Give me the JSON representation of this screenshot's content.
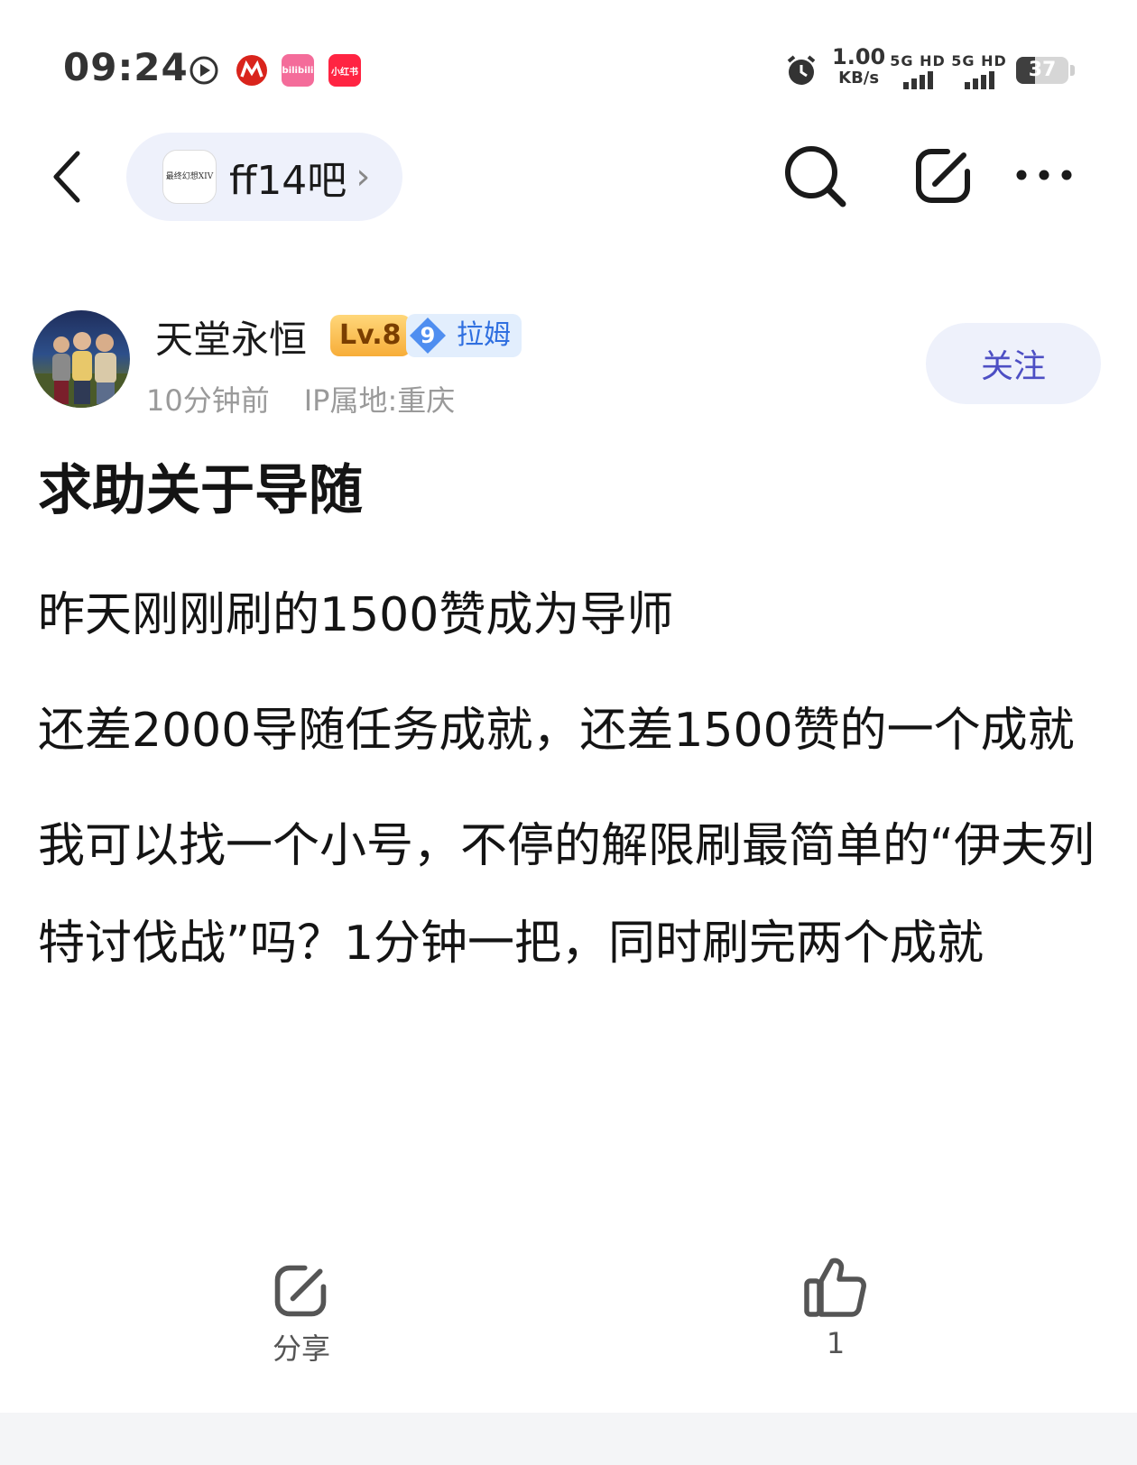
{
  "status_bar": {
    "time": "09:24",
    "app_icons": [
      {
        "name": "play-circle-icon"
      },
      {
        "name": "china-merchants-bank-icon",
        "color": "#d9241c"
      },
      {
        "name": "bilibili-icon",
        "label": "bilibili",
        "color": "#f46c9a"
      },
      {
        "name": "xiaohongshu-icon",
        "label": "小红书",
        "color": "#ff2442"
      }
    ],
    "alarm_icon": "alarm-clock-icon",
    "net_speed_value": "1.00",
    "net_speed_unit": "KB/s",
    "sim1": "5G HD",
    "sim2": "5G HD",
    "battery": "37"
  },
  "header": {
    "back_icon": "chevron-left-icon",
    "forum_logo_text": "最终幻想XIV",
    "forum_name": "ff14吧",
    "forum_chevron": "›",
    "search_icon": "search-icon",
    "share_icon": "share-edit-icon",
    "more_icon": "more-dots-icon"
  },
  "author": {
    "name": "天堂永恒",
    "level": "Lv.8",
    "fan_level": "9",
    "fan_label": "拉姆",
    "time": "10分钟前",
    "ip": "IP属地:重庆",
    "follow_label": "关注"
  },
  "post": {
    "title": "求助关于导随",
    "paragraphs": [
      "昨天刚刚刷的1500赞成为导师",
      "还差2000导随任务成就，还差1500赞的一个成就",
      "我可以找一个小号，不停的解限刷最简单的“伊夫列特讨伐战”吗？1分钟一把，同时刷完两个成就"
    ]
  },
  "actions": {
    "share_label": "分享",
    "like_count": "1"
  },
  "colors": {
    "accent": "#4d4fc4",
    "pill_bg": "#eef1fb",
    "level_badge": "#f7ad39",
    "fan_badge": "#2f6fe0"
  }
}
